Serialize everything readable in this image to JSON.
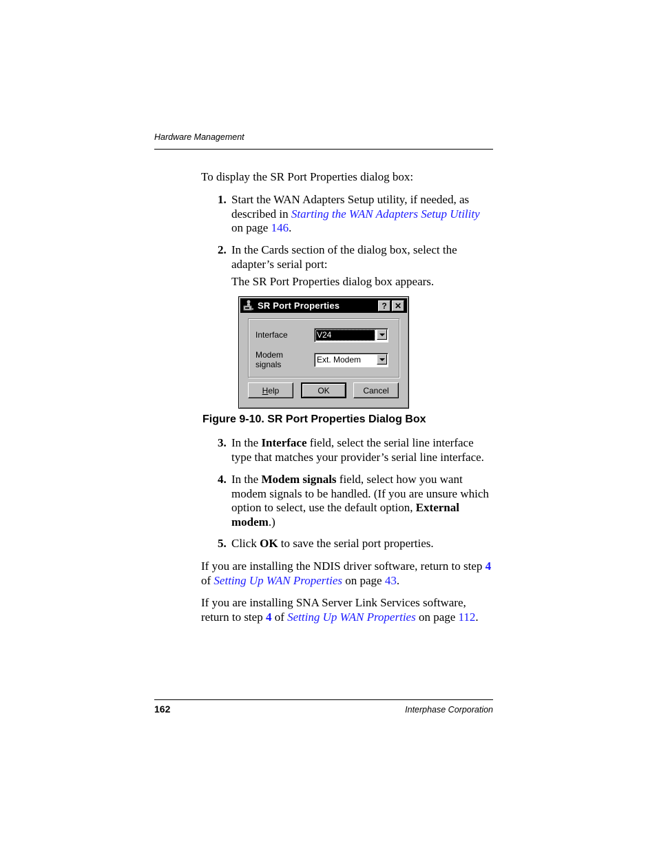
{
  "header": {
    "running_head": "Hardware Management"
  },
  "intro": "To display the SR Port Properties dialog box:",
  "steps": [
    {
      "num": "1.",
      "text_a": "Start the WAN Adapters Setup utility, if needed, as described in ",
      "link": "Starting the WAN Adapters Setup Utility",
      "text_b": " on page ",
      "page": "146",
      "text_c": "."
    },
    {
      "num": "2.",
      "text": "In the Cards section of the dialog box, select the adapter’s serial port:",
      "result": "The SR Port Properties dialog box appears."
    },
    {
      "num": "3.",
      "text_a": "In the ",
      "bold": "Interface",
      "text_b": " field, select the serial line interface type that matches your provider’s serial line interface."
    },
    {
      "num": "4.",
      "text_a": "In the ",
      "bold": "Modem signals",
      "text_b": " field, select how you want modem signals to be handled. (If you are unsure which option to select, use the default option, ",
      "bold2": "External modem",
      "text_c": ".)"
    },
    {
      "num": "5.",
      "text_a": "Click ",
      "bold": "OK",
      "text_b": " to save the serial port properties."
    }
  ],
  "figure": {
    "caption": "Figure 9-10.  SR Port Properties Dialog Box",
    "dialog": {
      "title": "SR Port  Properties",
      "help_glyph": "?",
      "close_glyph": "✕",
      "interface_label": "Interface",
      "interface_value": "V24",
      "modem_label": "Modem signals",
      "modem_value": "Ext. Modem",
      "help_button_mnemonic": "H",
      "help_button_rest": "elp",
      "ok_button": "OK",
      "cancel_button": "Cancel"
    }
  },
  "paragraphs": [
    {
      "text_a": "If you are installing the NDIS driver software, return to step ",
      "step": "4",
      "text_b": " of ",
      "link": "Setting Up WAN Properties",
      "text_c": " on page ",
      "page": "43",
      "text_d": "."
    },
    {
      "text_a": "If you are installing SNA Server Link Services software, return to step ",
      "step": "4",
      "text_b": " of ",
      "link": "Setting Up WAN Properties",
      "text_c": " on page ",
      "page": "112",
      "text_d": "."
    }
  ],
  "footer": {
    "page_number": "162",
    "company": "Interphase Corporation"
  },
  "colors": {
    "link": "#1a1aff",
    "dialog_face": "#c0c0c0",
    "titlebar": "#000000"
  }
}
